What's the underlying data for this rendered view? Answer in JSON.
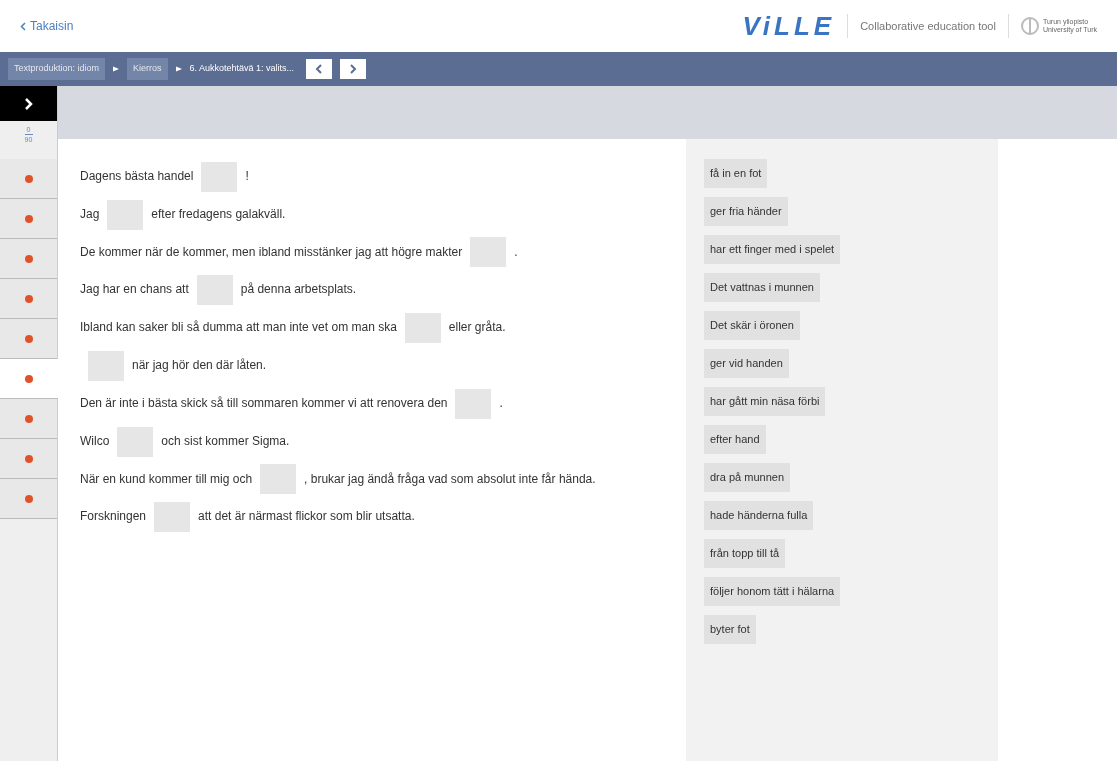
{
  "header": {
    "back_link": "Takaisin",
    "logo": "ViLLE",
    "tagline": "Collaborative education tool",
    "university": [
      "Turun yliopisto",
      "University of Turk"
    ]
  },
  "breadcrumbs": [
    {
      "label": "Textproduktion: idiom",
      "kind": "link"
    },
    {
      "label": "Kierros",
      "kind": "link"
    },
    {
      "label": "6. Aukkotehtävä 1: valits...",
      "kind": "current"
    }
  ],
  "sidebar": {
    "expanded": false
  },
  "score": {
    "points": "0",
    "max": "90"
  },
  "tasks": [
    {
      "selected": false,
      "color": "#e0522a"
    },
    {
      "selected": false,
      "color": "#e0522a"
    },
    {
      "selected": false,
      "color": "#e0522a"
    },
    {
      "selected": false,
      "color": "#e0522a"
    },
    {
      "selected": false,
      "color": "#e0522a"
    },
    {
      "selected": true,
      "color": "#e0522a"
    },
    {
      "selected": false,
      "color": "#e0522a"
    },
    {
      "selected": false,
      "color": "#e0522a"
    },
    {
      "selected": false,
      "color": "#e0522a"
    }
  ],
  "sentences": [
    [
      {
        "kind": "text",
        "text": "Dagens bästa handel"
      },
      {
        "kind": "blank"
      },
      {
        "kind": "text",
        "text": "!"
      }
    ],
    [
      {
        "kind": "text",
        "text": "Jag"
      },
      {
        "kind": "blank"
      },
      {
        "kind": "text",
        "text": "efter fredagens galakväll."
      }
    ],
    [
      {
        "kind": "text",
        "text": "De kommer när de kommer, men ibland misstänker jag att högre makter"
      },
      {
        "kind": "blank"
      },
      {
        "kind": "text",
        "text": "."
      }
    ],
    [
      {
        "kind": "text",
        "text": "Jag har en chans att"
      },
      {
        "kind": "blank"
      },
      {
        "kind": "text",
        "text": "på denna arbetsplats."
      }
    ],
    [
      {
        "kind": "text",
        "text": "Ibland kan saker bli så dumma att man inte vet om man ska"
      },
      {
        "kind": "blank"
      },
      {
        "kind": "text",
        "text": "eller gråta."
      }
    ],
    [
      {
        "kind": "blank"
      },
      {
        "kind": "text",
        "text": "när jag hör den där låten."
      }
    ],
    [
      {
        "kind": "text",
        "text": "Den är inte i bästa skick så till sommaren kommer vi att renovera den"
      },
      {
        "kind": "blank"
      },
      {
        "kind": "text",
        "text": "."
      }
    ],
    [
      {
        "kind": "text",
        "text": "Wilco"
      },
      {
        "kind": "blank"
      },
      {
        "kind": "text",
        "text": "och sist kommer Sigma."
      }
    ],
    [
      {
        "kind": "text",
        "text": "När en kund kommer till mig och"
      },
      {
        "kind": "blank"
      },
      {
        "kind": "text",
        "text": ", brukar jag ändå fråga vad som absolut inte får hända."
      }
    ],
    [
      {
        "kind": "text",
        "text": "Forskningen"
      },
      {
        "kind": "blank"
      },
      {
        "kind": "text",
        "text": "att det är närmast flickor som blir utsatta."
      }
    ]
  ],
  "options": [
    "få in en fot",
    "ger fria händer",
    "har ett finger med i spelet",
    "Det vattnas i munnen",
    "Det skär i öronen",
    "ger vid handen",
    "har gått min näsa förbi",
    "efter hand",
    "dra på munnen",
    "hade händerna fulla",
    "från topp till tå",
    "följer honom tätt i hälarna",
    "byter fot"
  ]
}
